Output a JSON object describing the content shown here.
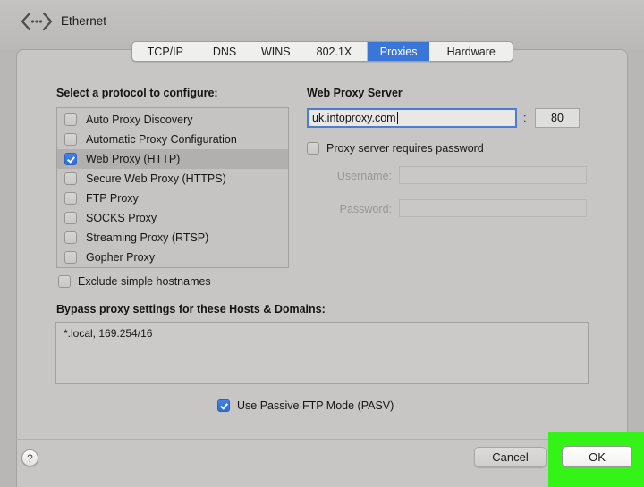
{
  "window": {
    "title": "Ethernet"
  },
  "tabs": [
    {
      "label": "TCP/IP",
      "selected": false
    },
    {
      "label": "DNS",
      "selected": false
    },
    {
      "label": "WINS",
      "selected": false
    },
    {
      "label": "802.1X",
      "selected": false
    },
    {
      "label": "Proxies",
      "selected": true
    },
    {
      "label": "Hardware",
      "selected": false
    }
  ],
  "protocol_panel": {
    "label": "Select a protocol to configure:",
    "items": [
      {
        "label": "Auto Proxy Discovery",
        "checked": false,
        "selected": false
      },
      {
        "label": "Automatic Proxy Configuration",
        "checked": false,
        "selected": false
      },
      {
        "label": "Web Proxy (HTTP)",
        "checked": true,
        "selected": true
      },
      {
        "label": "Secure Web Proxy (HTTPS)",
        "checked": false,
        "selected": false
      },
      {
        "label": "FTP Proxy",
        "checked": false,
        "selected": false
      },
      {
        "label": "SOCKS Proxy",
        "checked": false,
        "selected": false
      },
      {
        "label": "Streaming Proxy (RTSP)",
        "checked": false,
        "selected": false
      },
      {
        "label": "Gopher Proxy",
        "checked": false,
        "selected": false
      }
    ]
  },
  "exclude_hostnames": {
    "label": "Exclude simple hostnames",
    "checked": false
  },
  "web_proxy": {
    "label": "Web Proxy Server",
    "server_value": "uk.intoproxy.com",
    "port_separator": ":",
    "port_value": "80",
    "requires_password": {
      "label": "Proxy server requires password",
      "checked": false
    },
    "username_label": "Username:",
    "password_label": "Password:",
    "username_value": "",
    "password_value": ""
  },
  "bypass": {
    "label": "Bypass proxy settings for these Hosts & Domains:",
    "value": "*.local, 169.254/16"
  },
  "passive_ftp": {
    "label": "Use Passive FTP Mode (PASV)",
    "checked": true
  },
  "footer": {
    "help_label": "?",
    "cancel_label": "Cancel",
    "ok_label": "OK"
  },
  "colors": {
    "accent_blue": "#3a76d8",
    "highlight_green": "#33f317"
  }
}
